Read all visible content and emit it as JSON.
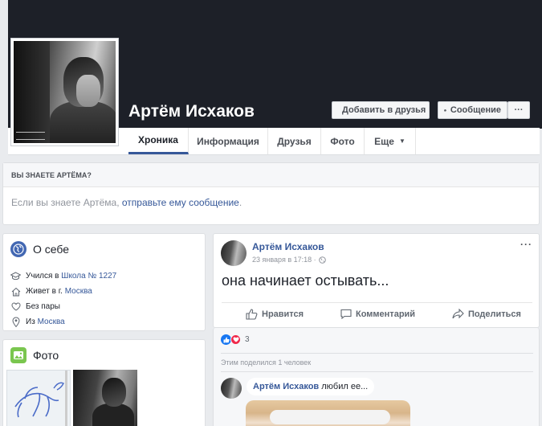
{
  "profile": {
    "name": "Артём Исхаков",
    "add_friend_label": "Добавить в друзья",
    "message_label": "Сообщение",
    "more_label": "···"
  },
  "tabs": [
    {
      "label": "Хроника",
      "active": true
    },
    {
      "label": "Информация",
      "active": false
    },
    {
      "label": "Друзья",
      "active": false
    },
    {
      "label": "Фото",
      "active": false
    },
    {
      "label": "Еще",
      "active": false
    }
  ],
  "know": {
    "heading": "ВЫ ЗНАЕТЕ АРТЁМА?",
    "text_prefix": "Если вы знаете Артёма, ",
    "link": "отправьте ему сообщение",
    "text_suffix": "."
  },
  "about": {
    "title": "О себе",
    "items": [
      {
        "icon": "graduation-cap-icon",
        "prefix": "Учился в ",
        "link": "Школа № 1227"
      },
      {
        "icon": "home-icon",
        "prefix": "Живет в г. ",
        "link": "Москва"
      },
      {
        "icon": "heart-icon",
        "prefix": "Без пары",
        "link": ""
      },
      {
        "icon": "location-pin-icon",
        "prefix": "Из ",
        "link": "Москва"
      }
    ]
  },
  "photos": {
    "title": "Фото"
  },
  "post": {
    "author": "Артём Исхаков",
    "date": "23 января в 17:18 ·",
    "text": "она начинает остывать...",
    "like_label": "Нравится",
    "comment_label": "Комментарий",
    "share_label": "Поделиться",
    "more": "···"
  },
  "reactions": {
    "count": "3",
    "shared": "Этим поделился 1 человек"
  },
  "comment": {
    "author": "Артём Исхаков",
    "text": " любил ее..."
  },
  "colors": {
    "link": "#365899",
    "cover": "#1d2028",
    "like": "#1877f2",
    "love": "#f0284a"
  }
}
